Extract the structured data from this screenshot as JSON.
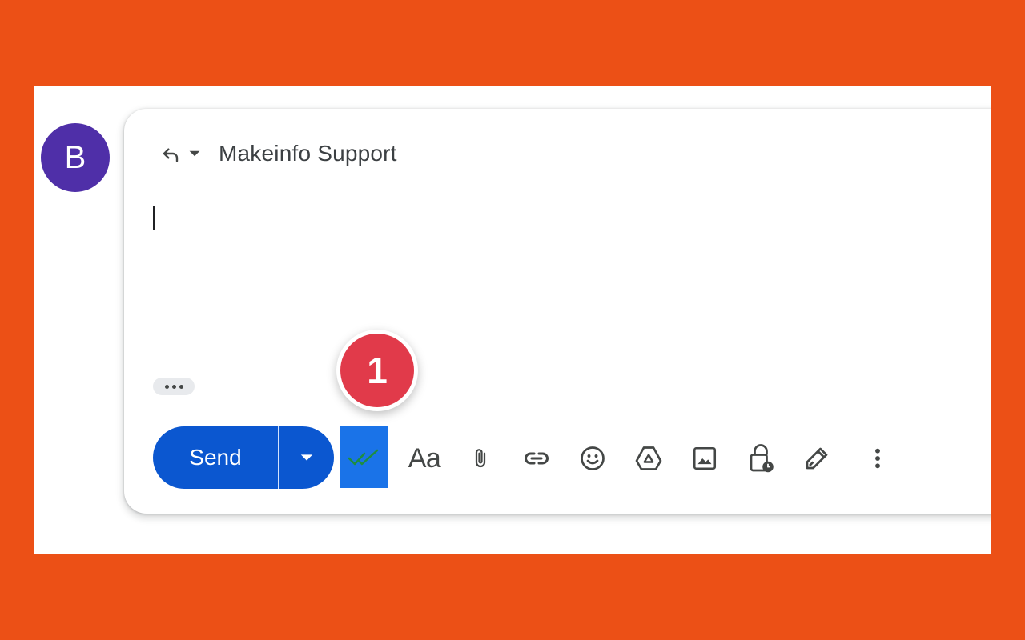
{
  "colors": {
    "background": "#ec5016",
    "avatar": "#4f2fa8",
    "send_button": "#0b57d0",
    "extension_button": "#1a73e8",
    "badge": "#e13a4a"
  },
  "avatar": {
    "initial": "B"
  },
  "compose": {
    "recipient": "Makeinfo Support",
    "body_text": ""
  },
  "toolbar": {
    "send_label": "Send",
    "format_label": "Aa",
    "icons": [
      "reply-icon",
      "dropdown-caret-icon",
      "send-options-caret-icon",
      "double-check-icon",
      "formatting-options-icon",
      "attach-icon",
      "link-icon",
      "emoji-icon",
      "drive-icon",
      "photo-icon",
      "confidential-mode-icon",
      "signature-icon",
      "more-options-icon"
    ]
  },
  "callout": {
    "step_number": "1"
  }
}
